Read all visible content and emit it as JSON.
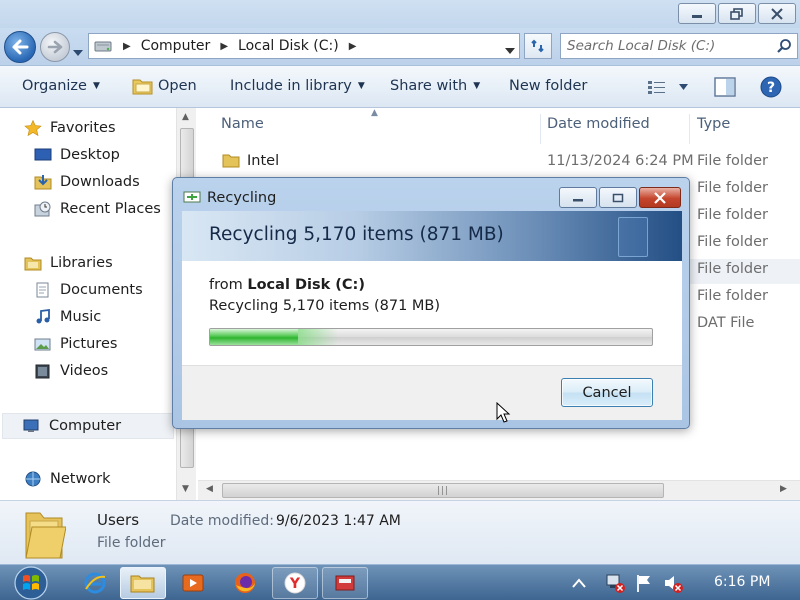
{
  "address_bar": {
    "crumbs": [
      "Computer",
      "Local Disk (C:)"
    ],
    "search_placeholder": "Search Local Disk (C:)"
  },
  "toolbar": {
    "organize": "Organize",
    "open": "Open",
    "include_in_library": "Include in library",
    "share_with": "Share with",
    "new_folder": "New folder"
  },
  "nav_pane": {
    "favorites": "Favorites",
    "desktop": "Desktop",
    "downloads": "Downloads",
    "recent_places": "Recent Places",
    "libraries": "Libraries",
    "documents": "Documents",
    "music": "Music",
    "pictures": "Pictures",
    "videos": "Videos",
    "computer": "Computer",
    "network": "Network"
  },
  "file_list": {
    "columns": {
      "name": "Name",
      "date_modified": "Date modified",
      "type": "Type"
    },
    "rows": [
      {
        "name": "Intel",
        "date": "11/13/2024 6:24 PM",
        "type": "File folder"
      },
      {
        "name": "",
        "date": "",
        "type": "File folder"
      },
      {
        "name": "",
        "date": "",
        "type": "File folder"
      },
      {
        "name": "",
        "date": "",
        "type": "File folder"
      },
      {
        "name": "",
        "date": "",
        "type": "File folder"
      },
      {
        "name": "",
        "date": "",
        "type": "File folder"
      },
      {
        "name": "",
        "date": "",
        "type": "DAT File"
      }
    ]
  },
  "details_pane": {
    "name": "Users",
    "date_label": "Date modified:",
    "date_value": "9/6/2023 1:47 AM",
    "type": "File folder"
  },
  "dialog": {
    "title": "Recycling",
    "banner": "Recycling 5,170 items (871 MB)",
    "from_prefix": "from ",
    "from_location": "Local Disk (C:)",
    "status": "Recycling 5,170 items (871 MB)",
    "progress": 0.2,
    "cancel_label": "Cancel"
  },
  "taskbar": {
    "clock": "6:16 PM",
    "pinned": [
      "start-orb",
      "internet-explorer-icon",
      "explorer-icon",
      "media-player-icon",
      "firefox-icon",
      "yandex-icon",
      "recycle-app-icon"
    ]
  }
}
